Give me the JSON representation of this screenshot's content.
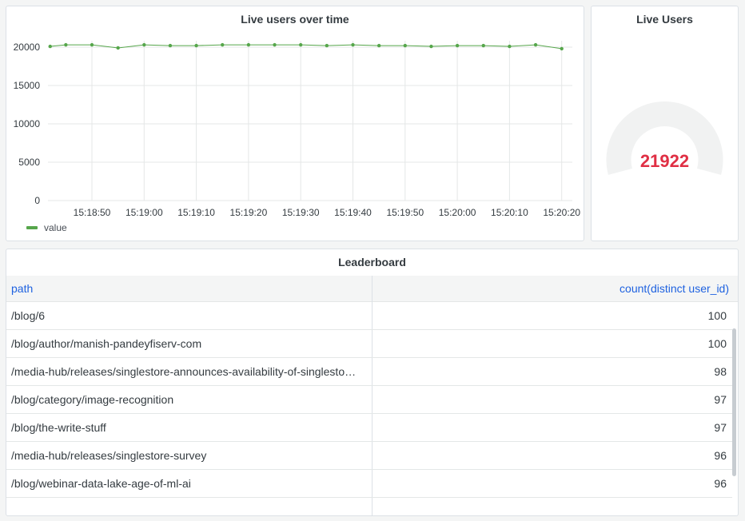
{
  "chart_panel": {
    "title": "Live users over time",
    "legend_label": "value",
    "line_color": "#56a64b"
  },
  "chart_data": {
    "type": "line",
    "title": "Live users over time",
    "xlabel": "",
    "ylabel": "",
    "ylim": [
      0,
      20000
    ],
    "yticks": [
      "0",
      "5000",
      "10000",
      "15000",
      "20000"
    ],
    "xticks": [
      "15:18:50",
      "15:19:00",
      "15:19:10",
      "15:19:20",
      "15:19:30",
      "15:19:40",
      "15:19:50",
      "15:20:00",
      "15:20:10",
      "15:20:20"
    ],
    "xtick_times": [
      "15:18:50",
      "15:19:00",
      "15:19:10",
      "15:19:20",
      "15:19:30",
      "15:19:40",
      "15:19:50",
      "15:20:00",
      "15:20:10",
      "15:20:20"
    ],
    "grid": true,
    "legend": "bottom-left",
    "series": [
      {
        "name": "value",
        "x": [
          "15:18:42",
          "15:18:45",
          "15:18:50",
          "15:18:55",
          "15:19:00",
          "15:19:05",
          "15:19:10",
          "15:19:15",
          "15:19:20",
          "15:19:25",
          "15:19:30",
          "15:19:35",
          "15:19:40",
          "15:19:45",
          "15:19:50",
          "15:19:55",
          "15:20:00",
          "15:20:05",
          "15:20:10",
          "15:20:15",
          "15:20:20"
        ],
        "values": [
          20100,
          20300,
          20300,
          19900,
          20300,
          20200,
          20200,
          20300,
          20300,
          20300,
          20300,
          20200,
          20300,
          20200,
          20200,
          20100,
          20200,
          20200,
          20100,
          20300,
          19800
        ]
      }
    ]
  },
  "gauge_panel": {
    "title": "Live Users",
    "value": "21922",
    "fill_fraction": 0,
    "value_color": "#e02f44",
    "track_color": "#f1f2f2"
  },
  "leaderboard": {
    "title": "Leaderboard",
    "columns": [
      "path",
      "count(distinct user_id)"
    ],
    "rows": [
      [
        "/blog/6",
        "100"
      ],
      [
        "/blog/author/manish-pandeyfiserv-com",
        "100"
      ],
      [
        "/media-hub/releases/singlestore-announces-availability-of-singlesto…",
        "98"
      ],
      [
        "/blog/category/image-recognition",
        "97"
      ],
      [
        "/blog/the-write-stuff",
        "97"
      ],
      [
        "/media-hub/releases/singlestore-survey",
        "96"
      ],
      [
        "/blog/webinar-data-lake-age-of-ml-ai",
        "96"
      ],
      [
        "",
        ""
      ]
    ]
  }
}
